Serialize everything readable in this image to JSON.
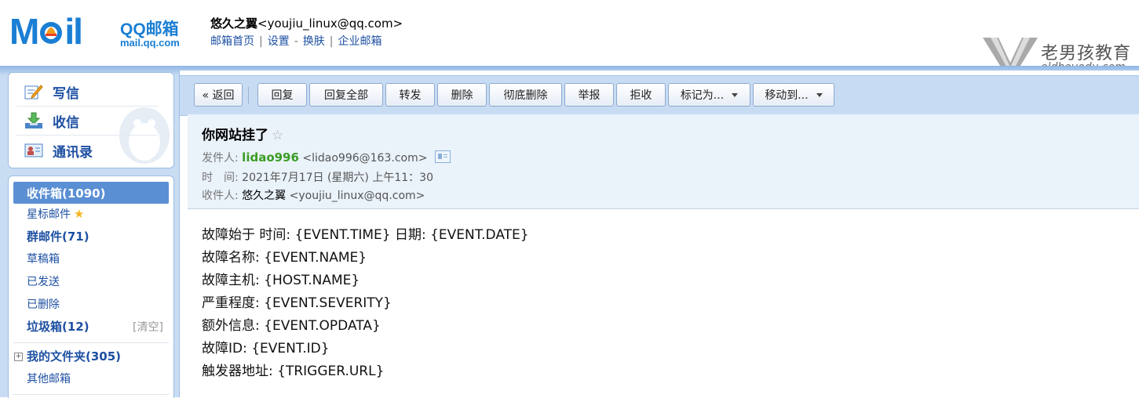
{
  "header": {
    "logo_text": "M  il",
    "logo_brand": "QQ邮箱",
    "logo_domain": "mail.qq.com",
    "user_name": "悠久之翼",
    "user_email": "<youjiu_linux@qq.com>",
    "links": [
      "邮箱首页",
      "设置",
      "换肤",
      "企业邮箱"
    ],
    "link_separators": [
      "|",
      "-",
      "|"
    ]
  },
  "watermark": {
    "text_cn": "老男孩教育",
    "text_en": "oldboyedu.com"
  },
  "sidebar": {
    "commands": [
      {
        "label": "写信",
        "icon": "compose-icon"
      },
      {
        "label": "收信",
        "icon": "inbox-download-icon"
      },
      {
        "label": "通讯录",
        "icon": "contacts-icon"
      }
    ],
    "folders": {
      "inbox": "收件箱(1090)",
      "starred": "星标邮件",
      "group": "群邮件(71)",
      "drafts": "草稿箱",
      "sent": "已发送",
      "deleted": "已删除",
      "spam": "垃圾箱(12)",
      "spam_clear": "[清空]",
      "my_folders": "我的文件夹(305)",
      "other": "其他邮箱"
    }
  },
  "toolbar": {
    "back": "« 返回",
    "reply": "回复",
    "reply_all": "回复全部",
    "forward": "转发",
    "delete": "删除",
    "delete_permanent": "彻底删除",
    "report": "举报",
    "reject": "拒收",
    "mark_as": "标记为...",
    "move_to": "移动到..."
  },
  "message": {
    "subject": "你网站挂了",
    "star": "☆",
    "from_label": "发件人:",
    "from_name": "lidao996",
    "from_email": "<lidao996@163.com>",
    "time_label": "时　间:",
    "time_value": "2021年7月17日 (星期六) 上午11：30",
    "to_label": "收件人:",
    "to_name": "悠久之翼",
    "to_email": "<youjiu_linux@qq.com>",
    "body": [
      "故障始于 时间: {EVENT.TIME} 日期: {EVENT.DATE}",
      "故障名称: {EVENT.NAME}",
      "故障主机: {HOST.NAME}",
      "严重程度: {EVENT.SEVERITY}",
      "额外信息: {EVENT.OPDATA}",
      "故障ID: {EVENT.ID}",
      "触发器地址: {TRIGGER.URL}"
    ]
  },
  "colors": {
    "brand_blue": "#1a7fd4",
    "link_blue": "#1e50a2",
    "selected_folder": "#5a8fd4",
    "sender_green": "#3a9d23",
    "toolbar_bg": "#c7dcf3",
    "header_bg": "#eaf2fa"
  }
}
